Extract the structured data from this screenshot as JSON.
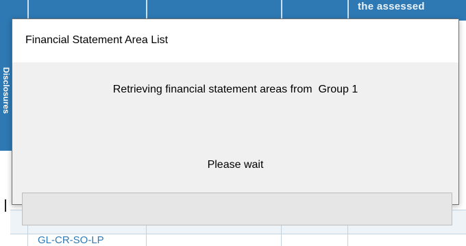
{
  "background": {
    "header_text": "the assessed",
    "side_label": "Disclosures",
    "cell_text": "GL-CR-SO-LP"
  },
  "dialog": {
    "title": "Financial Statement Area List",
    "message": "Retrieving financial statement areas from  Group 1",
    "wait_text": "Please wait",
    "progress": 0
  },
  "colors": {
    "accent": "#2e79b4",
    "dialog_bg": "#f0f0f0",
    "titlebar_bg": "#ffffff",
    "progress_track": "#e6e6e6",
    "progress_fill": "#06b025"
  }
}
